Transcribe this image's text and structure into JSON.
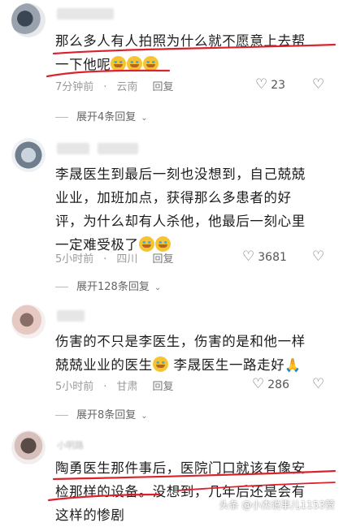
{
  "comments": [
    {
      "text_a": "那么多人有人拍照为什么就不愿意上去帮",
      "text_b": "一下他呢",
      "time": "7分钟前",
      "location": "云南",
      "reply": "回复",
      "likes": "23",
      "expand": "展开4条回复"
    },
    {
      "text_a": "李晟医生到最后一刻也没想到，自己兢兢",
      "text_b": "业业，加班加点，获得那么多患者的好",
      "text_c": "评，为什么却有人杀他，他最后一刻心里",
      "text_d": "一定难受极了",
      "time": "5小时前",
      "location": "四川",
      "reply": "回复",
      "likes": "3681",
      "expand": "展开128条回复"
    },
    {
      "text_a": "伤害的不只是李医生，伤害的是和他一样",
      "text_b": "兢兢业业的医生",
      "text_b2": " 李晟医生一路走好",
      "time": "5小时前",
      "location": "甘肃",
      "reply": "回复",
      "likes": "286",
      "expand": "展开8条回复"
    },
    {
      "username": "小明路",
      "text_a": "陶勇医生那件事后，医院门口就该有像安",
      "text_b": "检那样的设备。没想到，几年后还是会有",
      "text_c": "这样的惨剧"
    }
  ],
  "watermark": "头条 @小杰说事儿1153赞",
  "colors": {
    "underline": "#d9232e",
    "meta": "#9a9a9a"
  }
}
